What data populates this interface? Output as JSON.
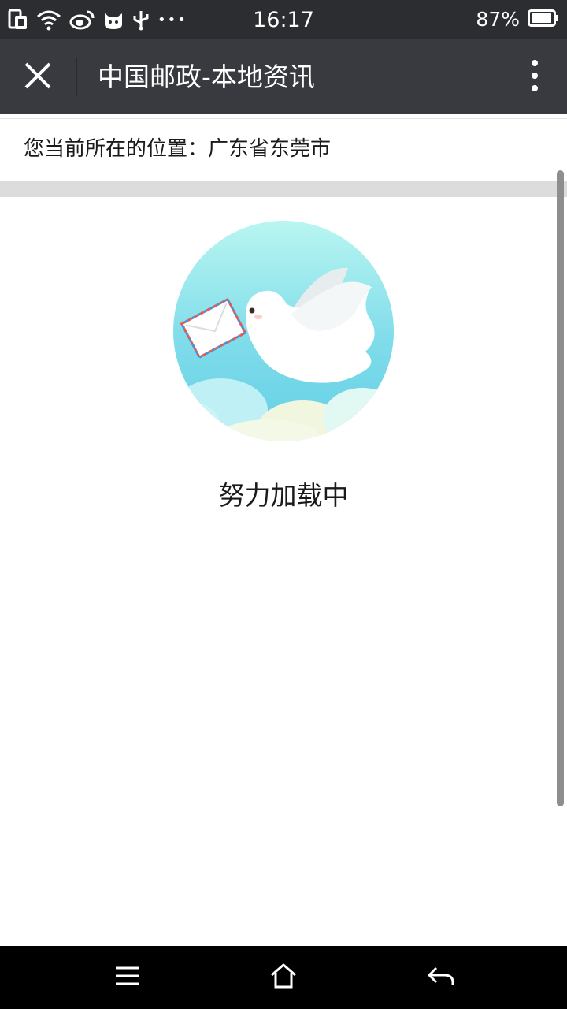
{
  "status_bar": {
    "time": "16:17",
    "battery_percent": "87%",
    "icons": [
      "sim-card-icon",
      "wifi-icon",
      "weibo-icon",
      "cat-app-icon",
      "usb-icon",
      "more-notifications-icon",
      "battery-icon"
    ],
    "more_notifications": "•••"
  },
  "title_bar": {
    "title": "中国邮政-本地资讯",
    "close_icon": "close-icon",
    "menu_icon": "more-vertical-icon"
  },
  "content": {
    "location": "您当前所在的位置：广东省东莞市",
    "loading_text": "努力加载中",
    "loading_image": "dove-carrying-letter-illustration"
  },
  "nav_bar": {
    "icons": [
      "menu-icon",
      "home-icon",
      "back-icon"
    ]
  },
  "colors": {
    "status_bar_bg": "#2b2d30",
    "title_bar_bg": "#393a3f",
    "separator_band": "#dcdcdc",
    "sky_blue": "#7fdcea",
    "nav_bar_bg": "#000000"
  }
}
